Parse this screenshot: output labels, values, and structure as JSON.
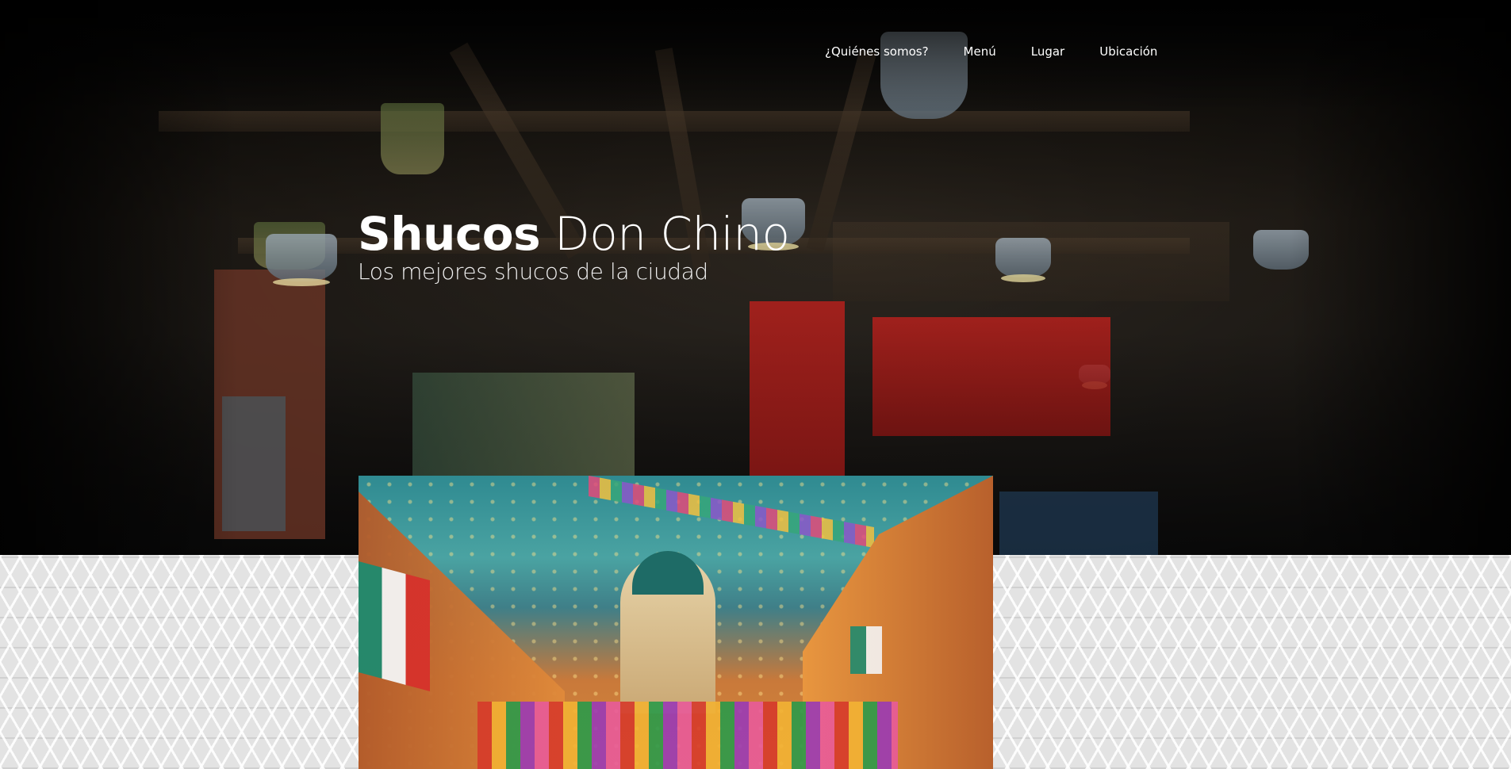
{
  "nav": {
    "items": [
      {
        "label": "¿Quiénes somos?"
      },
      {
        "label": "Menú"
      },
      {
        "label": "Lugar"
      },
      {
        "label": "Ubicación"
      }
    ]
  },
  "hero": {
    "title_strong": "Shucos",
    "title_rest": " Don Chino",
    "subtitle": "Los mejores shucos de la ciudad"
  },
  "colors": {
    "hero_overlay": "#000000",
    "nav_text": "#ffffff",
    "pattern_background": "#e3e3e3"
  }
}
